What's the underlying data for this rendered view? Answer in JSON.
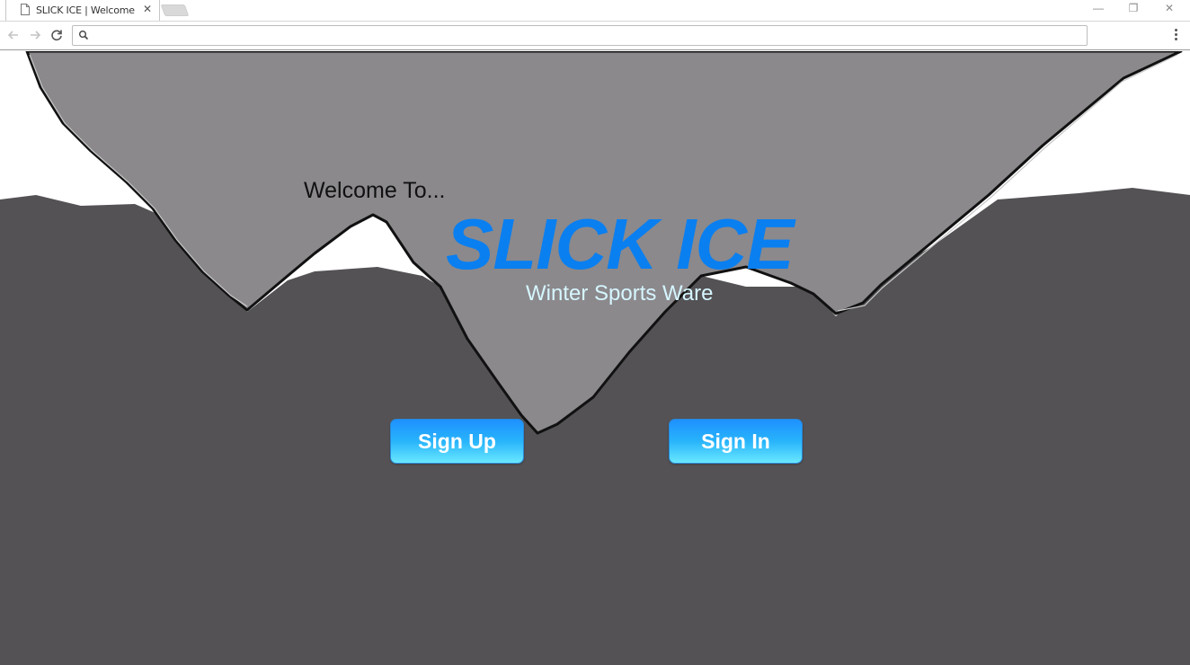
{
  "browser": {
    "tab_title": "SLICK ICE | Welcome",
    "tab_close_glyph": "✕",
    "address_value": "",
    "window_controls": {
      "minimize": "—",
      "restore": "❐",
      "close": "✕"
    },
    "icons": [
      "page-icon",
      "back-arrow-icon",
      "forward-arrow-icon",
      "reload-icon",
      "search-icon",
      "kebab-menu-icon"
    ]
  },
  "page": {
    "welcome_text": "Welcome To...",
    "brand_name": "SLICK ICE",
    "tagline": "Winter Sports Ware",
    "buttons": {
      "sign_up": "Sign Up",
      "sign_in": "Sign In"
    }
  },
  "colors": {
    "brand": "#0a7ff0",
    "tagline": "#d6f6ff",
    "mountain_dark": "#545255",
    "mountain_light": "#8b898c",
    "snow": "#ffffff",
    "button_top": "#1e90ff",
    "button_bottom": "#6ae8ff"
  }
}
